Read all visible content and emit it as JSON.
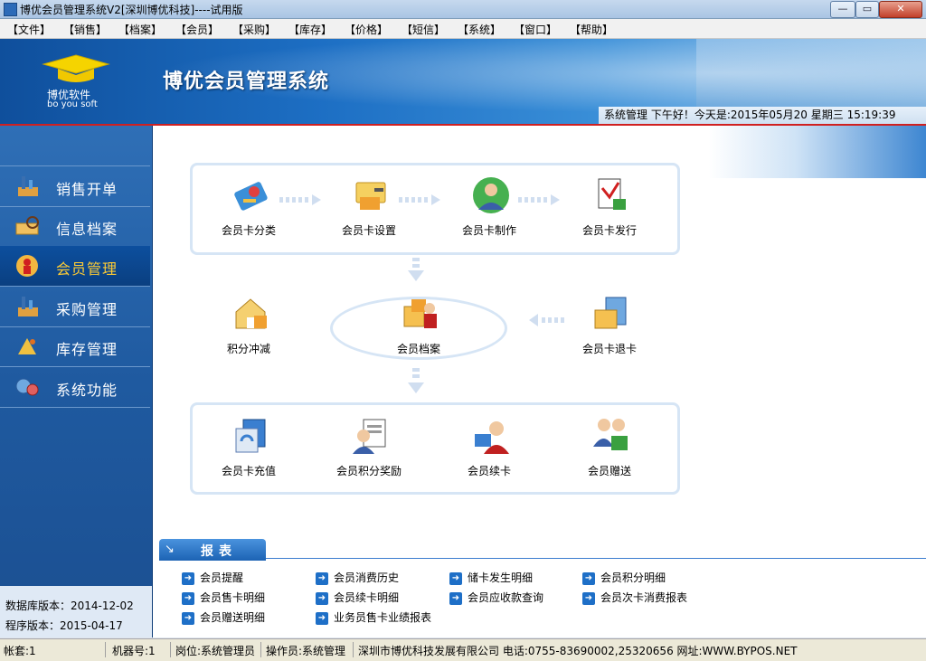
{
  "window": {
    "title": "博优会员管理系统V2[深圳博优科技]----试用版",
    "controls": [
      "minimize",
      "maximize",
      "close"
    ]
  },
  "menu": [
    "【文件】",
    "【销售】",
    "【档案】",
    "【会员】",
    "【采购】",
    "【库存】",
    "【价格】",
    "【短信】",
    "【系统】",
    "【窗口】",
    "【帮助】"
  ],
  "banner": {
    "logo_cn": "博优软件",
    "logo_en": "bo you soft",
    "app_title": "博优会员管理系统",
    "status": "系统管理  下午好！今天是:2015年05月20  星期三   15:19:39"
  },
  "sidebar": {
    "items": [
      {
        "label": "销售开单",
        "icon": "sales-icon",
        "active": false
      },
      {
        "label": "信息档案",
        "icon": "archive-icon",
        "active": false
      },
      {
        "label": "会员管理",
        "icon": "member-icon",
        "active": true
      },
      {
        "label": "采购管理",
        "icon": "purchase-icon",
        "active": false
      },
      {
        "label": "库存管理",
        "icon": "inventory-icon",
        "active": false
      },
      {
        "label": "系统功能",
        "icon": "system-icon",
        "active": false
      }
    ],
    "db_version": "数据库版本：2014-12-02",
    "app_version": "程序版本：2015-04-17"
  },
  "flow": {
    "row1": [
      {
        "label": "会员卡分类",
        "icon": "card-category-icon"
      },
      {
        "label": "会员卡设置",
        "icon": "card-settings-icon"
      },
      {
        "label": "会员卡制作",
        "icon": "card-make-icon"
      },
      {
        "label": "会员卡发行",
        "icon": "card-issue-icon"
      }
    ],
    "row2": [
      {
        "label": "积分冲减",
        "icon": "points-deduct-icon"
      },
      {
        "label": "会员档案",
        "icon": "member-archive-icon"
      },
      {
        "label": "会员卡退卡",
        "icon": "card-return-icon"
      }
    ],
    "row3": [
      {
        "label": "会员卡充值",
        "icon": "card-recharge-icon"
      },
      {
        "label": "会员积分奖励",
        "icon": "points-reward-icon"
      },
      {
        "label": "会员续卡",
        "icon": "card-renew-icon"
      },
      {
        "label": "会员赠送",
        "icon": "member-gift-icon"
      }
    ]
  },
  "reports": {
    "tab": "报表",
    "items": [
      "会员提醒",
      "会员消费历史",
      "储卡发生明细",
      "会员积分明细",
      "会员售卡明细",
      "会员续卡明细",
      "会员应收款查询",
      "会员次卡消费报表",
      "会员赠送明细",
      "业务员售卡业绩报表"
    ]
  },
  "statusbar": {
    "account": "帐套:1",
    "machine": "机器号:1",
    "post": "岗位:系统管理员",
    "operator": "操作员:系统管理",
    "company": "深圳市博优科技发展有限公司 电话:0755-83690002,25320656 网址:WWW.BYPOS.NET"
  },
  "colors": {
    "banner": "#1d6fc4",
    "sidebar": "#2f6fb6",
    "active_label": "#ffcc33",
    "panel_border": "#d6e5f5",
    "accent_line": "#d02020"
  }
}
